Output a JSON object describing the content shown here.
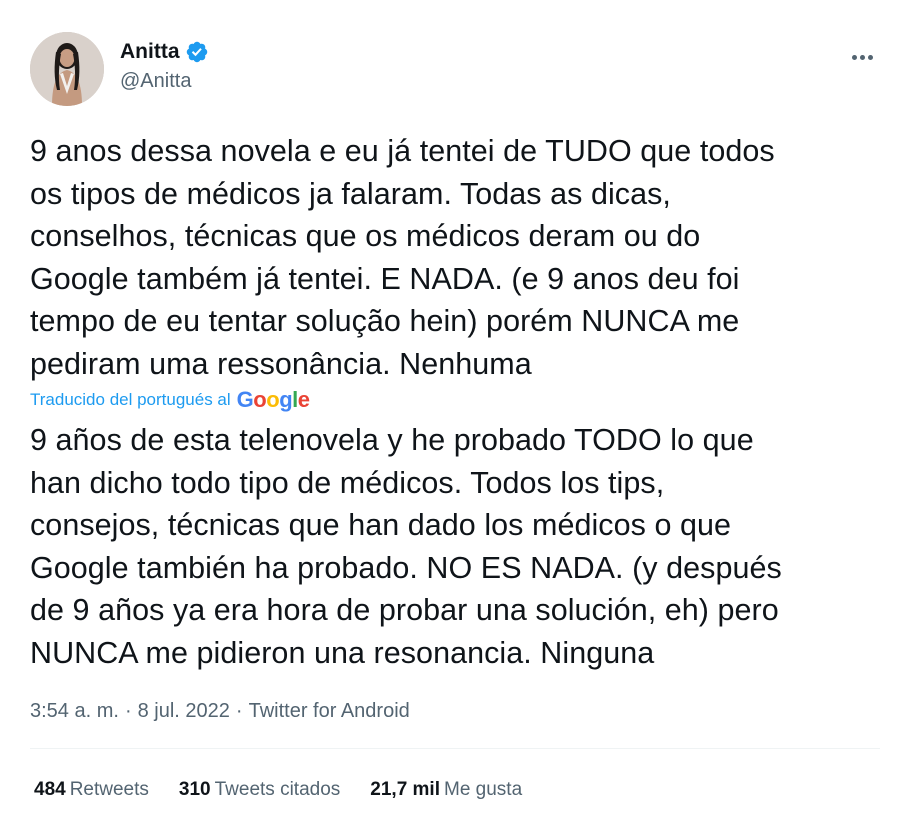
{
  "author": {
    "display_name": "Anitta",
    "handle": "@Anitta",
    "verified": true,
    "avatar_icon": "profile-photo"
  },
  "tweet": {
    "text": "9 anos dessa novela e eu já tentei de TUDO que todos\nos tipos de médicos ja falaram. Todas as dicas,\nconselhos, técnicas que os médicos deram ou do\nGoogle também já tentei. E NADA. (e 9 anos deu foi\ntempo de eu tentar solução hein) porém NUNCA me\npediram uma ressonância. Nenhuma",
    "translation_label": "Traducido del portugués al",
    "translation_provider": "Google",
    "translated_text": "9 años de esta telenovela y he probado TODO lo que\nhan dicho todo tipo de médicos. Todos los tips,\nconsejos, técnicas que han dado los médicos o que\nGoogle también ha probado. NO ES NADA. (y después\nde 9 años ya era hora de probar una solución, eh) pero\nNUNCA me pidieron una resonancia. Ninguna"
  },
  "meta": {
    "time": "3:54 a. m.",
    "separator": "·",
    "date": "8 jul. 2022",
    "source": "Twitter for Android"
  },
  "stats": {
    "retweets_count": "484",
    "retweets_label": "Retweets",
    "quotes_count": "310",
    "quotes_label": "Tweets citados",
    "likes_count": "21,7 mil",
    "likes_label": "Me gusta"
  },
  "colors": {
    "text_primary": "#0f1419",
    "text_secondary": "#536471",
    "link_blue": "#1d9bf0",
    "verified_blue": "#1d9bf0",
    "divider": "#eff3f4"
  },
  "icons": {
    "verified": "verified-badge-icon",
    "more": "more-horizontal-icon"
  }
}
